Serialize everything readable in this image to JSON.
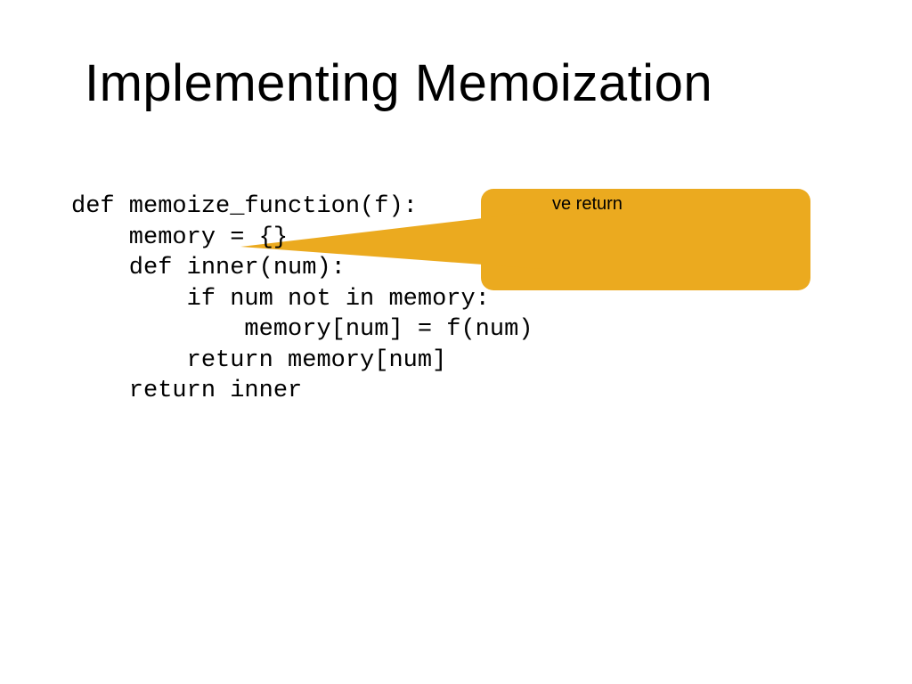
{
  "slide": {
    "title": "Implementing Memoization",
    "code": "def memoize_function(f):\n    memory = {}\n    def inner(num):\n        if num not in memory:\n            memory[num] = f(num)\n        return memory[num]\n    return inner",
    "callout": {
      "text_visible": "ve return",
      "bg_color": "#ebaa1f",
      "tail_color": "#ebaa1f"
    }
  }
}
